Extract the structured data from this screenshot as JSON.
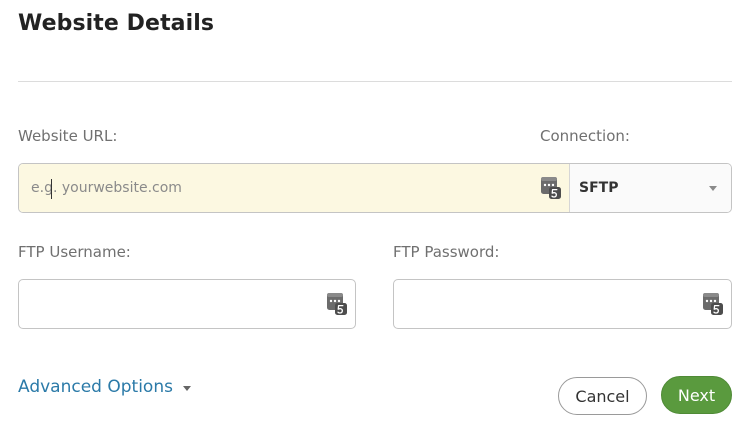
{
  "dialog": {
    "title": "Website Details"
  },
  "website_url": {
    "label": "Website URL:",
    "placeholder": "e.g. yourwebsite.com",
    "value": "",
    "autofill_icon": "password-manager-icon"
  },
  "connection": {
    "label": "Connection:",
    "selected": "SFTP",
    "icon": "chevron-down-icon"
  },
  "ftp_username": {
    "label": "FTP Username:",
    "value": "",
    "autofill_icon": "password-manager-icon"
  },
  "ftp_password": {
    "label": "FTP Password:",
    "value": "",
    "autofill_icon": "password-manager-icon"
  },
  "advanced_options": {
    "label": "Advanced Options",
    "icon": "chevron-down-icon"
  },
  "actions": {
    "cancel_label": "Cancel",
    "next_label": "Next"
  },
  "colors": {
    "link": "#2b7aa8",
    "primary_button": "#5a9a3e",
    "autofill_highlight": "#fcf8e1"
  }
}
